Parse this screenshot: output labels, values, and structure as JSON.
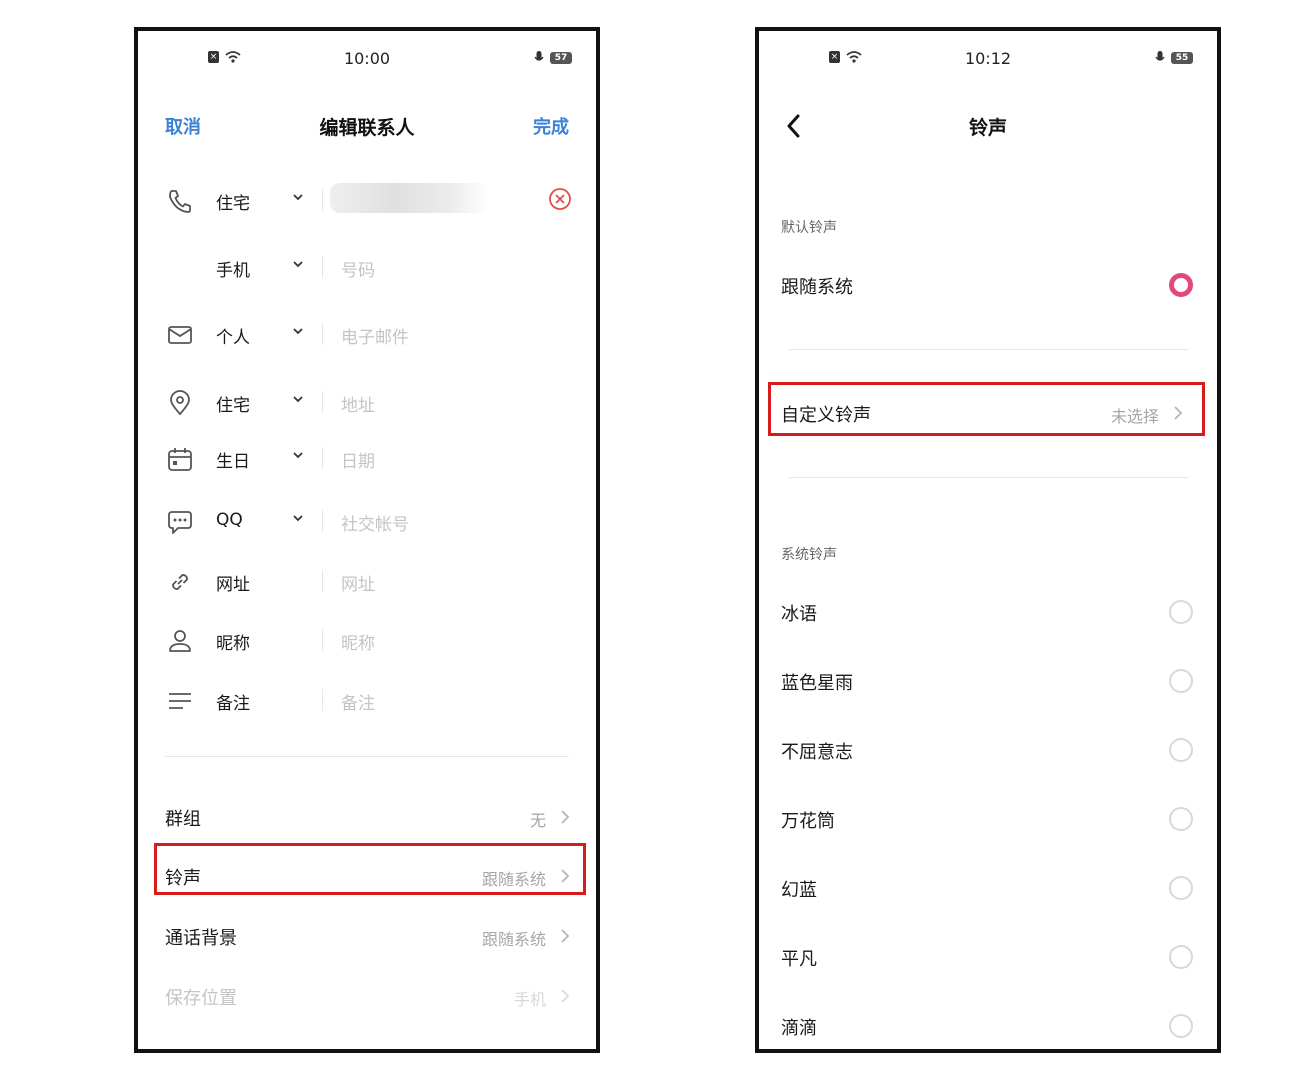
{
  "left": {
    "status": {
      "time": "10:00",
      "battery": "57"
    },
    "nav": {
      "cancel": "取消",
      "title": "编辑联系人",
      "done": "完成"
    },
    "fields": [
      {
        "icon": "phone-icon",
        "label": "住宅",
        "placeholder": ""
      },
      {
        "icon": "",
        "label": "手机",
        "placeholder": "号码"
      },
      {
        "icon": "mail-icon",
        "label": "个人",
        "placeholder": "电子邮件"
      },
      {
        "icon": "location-pin-icon",
        "label": "住宅",
        "placeholder": "地址"
      },
      {
        "icon": "calendar-icon",
        "label": "生日",
        "placeholder": "日期"
      },
      {
        "icon": "chat-bubble-icon",
        "label": "QQ",
        "placeholder": "社交帐号"
      },
      {
        "icon": "link-icon",
        "label": "网址",
        "placeholder": "网址"
      },
      {
        "icon": "person-icon",
        "label": "昵称",
        "placeholder": "昵称"
      },
      {
        "icon": "notes-lines-icon",
        "label": "备注",
        "placeholder": "备注"
      }
    ],
    "menu": [
      {
        "label": "群组",
        "value": "无"
      },
      {
        "label": "铃声",
        "value": "跟随系统"
      },
      {
        "label": "通话背景",
        "value": "跟随系统"
      },
      {
        "label": "保存位置",
        "value": "手机"
      }
    ]
  },
  "right": {
    "status": {
      "time": "10:12",
      "battery": "55"
    },
    "nav": {
      "title": "铃声"
    },
    "default_section": "默认铃声",
    "follow_system": "跟随系统",
    "custom": {
      "label": "自定义铃声",
      "value": "未选择"
    },
    "system_section": "系统铃声",
    "system_ringtones": [
      "冰语",
      "蓝色星雨",
      "不屈意志",
      "万花筒",
      "幻蓝",
      "平凡",
      "滴滴"
    ]
  },
  "colors": {
    "accent_blue": "#3b82d6",
    "highlight_red": "#d81b1b",
    "radio_pink": "#e2487a",
    "clear_red": "#e05050"
  }
}
